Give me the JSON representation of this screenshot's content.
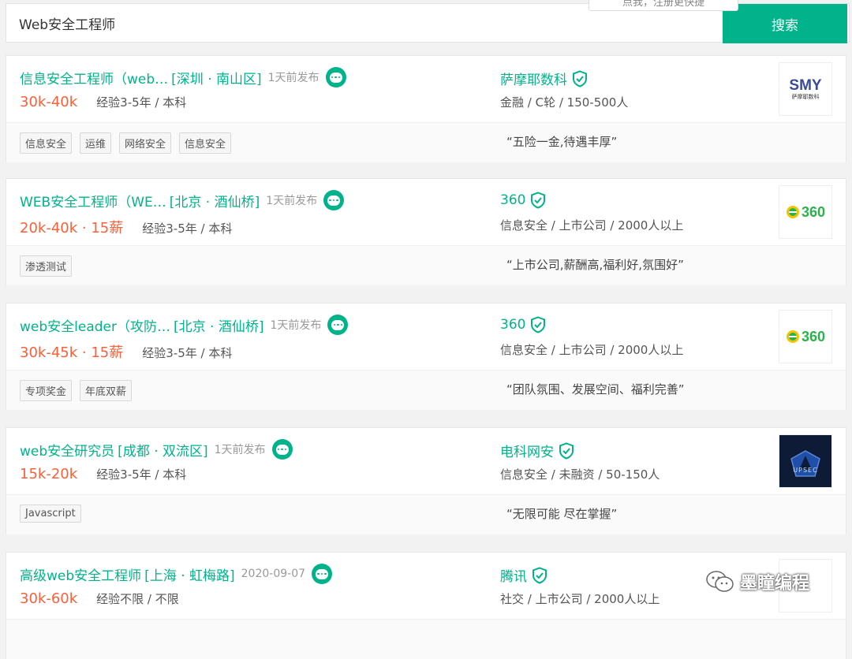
{
  "search": {
    "value": "Web安全工程师",
    "button": "搜索",
    "tooltip": "点我，注册更快捷"
  },
  "jobs": [
    {
      "title": "信息安全工程师（web…",
      "location": "[深圳 · 南山区]",
      "time": "1天前发布",
      "salary": "30k-40k",
      "requirement": "经验3-5年 / 本科",
      "company": "萨摩耶数科",
      "company_info": "金融 / C轮 / 150-500人",
      "tags": [
        "信息安全",
        "运维",
        "网络安全",
        "信息安全"
      ],
      "advantage": "“五险一金,待遇丰厚”",
      "logo": "smy"
    },
    {
      "title": "WEB安全工程师（WE…",
      "location": "[北京 · 酒仙桥]",
      "time": "1天前发布",
      "salary": "20k-40k · 15薪",
      "requirement": "经验3-5年 / 本科",
      "company": "360",
      "company_info": "信息安全 / 上市公司 / 2000人以上",
      "tags": [
        "渗透测试"
      ],
      "advantage": "“上市公司,薪酬高,福利好,氛围好”",
      "logo": "360"
    },
    {
      "title": "web安全leader（攻防…",
      "location": "[北京 · 酒仙桥]",
      "time": "1天前发布",
      "salary": "30k-45k · 15薪",
      "requirement": "经验3-5年 / 本科",
      "company": "360",
      "company_info": "信息安全 / 上市公司 / 2000人以上",
      "tags": [
        "专项奖金",
        "年底双薪"
      ],
      "advantage": "“团队氛围、发展空间、福利完善”",
      "logo": "360"
    },
    {
      "title": "web安全研究员",
      "location": "[成都 · 双流区]",
      "time": "1天前发布",
      "salary": "15k-20k",
      "requirement": "经验3-5年 / 本科",
      "company": "电科网安",
      "company_info": "信息安全 / 未融资 / 50-150人",
      "tags": [
        "Javascript"
      ],
      "advantage": "“无限可能 尽在掌握”",
      "logo": "upsec"
    },
    {
      "title": "高级web安全工程师",
      "location": "[上海 · 虹梅路]",
      "time": "2020-09-07",
      "salary": "30k-60k",
      "requirement": "经验不限 / 不限",
      "company": "腾讯",
      "company_info": "社交 / 上市公司 / 2000人以上",
      "tags": [],
      "advantage": "",
      "logo": "tencent"
    }
  ],
  "logos": {
    "smy_main": "SMY",
    "smy_sub": "萨摩耶数科",
    "brand_360": "360",
    "upsec": "UPSEC"
  },
  "watermark": "墨瞳编程",
  "colors": {
    "accent": "#00b38a",
    "salary": "#fd5f39"
  }
}
